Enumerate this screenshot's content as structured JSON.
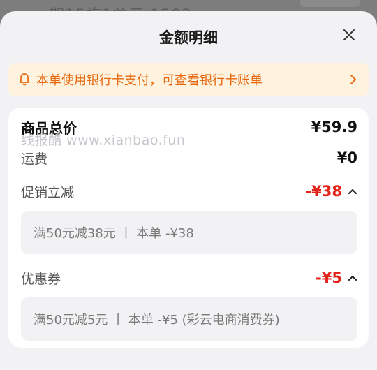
{
  "backdrop": {
    "text": "期15栋1单元 1502"
  },
  "sheet": {
    "title": "金额明细"
  },
  "notice": {
    "text": "本单使用银行卡支付，可查看银行卡账单"
  },
  "watermark": "线报酷 www.xianbao.fun",
  "rows": {
    "subtotal": {
      "label": "商品总价",
      "value": "¥59.9"
    },
    "shipping": {
      "label": "运费",
      "value": "¥0"
    },
    "promotion": {
      "label": "促销立减",
      "value": "-¥38",
      "detail": "满50元减38元  丨  本单 -¥38"
    },
    "coupon": {
      "label": "优惠券",
      "value": "-¥5",
      "detail": "满50元减5元  丨  本单 -¥5 (彩云电商消费券)"
    }
  },
  "colors": {
    "notice_text": "#e6690f",
    "notice_bg": "#fff3e0",
    "discount": "#e2231a"
  },
  "icons": {
    "close": "close-icon",
    "notice": "bell-icon",
    "notice_arrow": "chevron-right-icon",
    "expand": "chevron-up-icon"
  }
}
